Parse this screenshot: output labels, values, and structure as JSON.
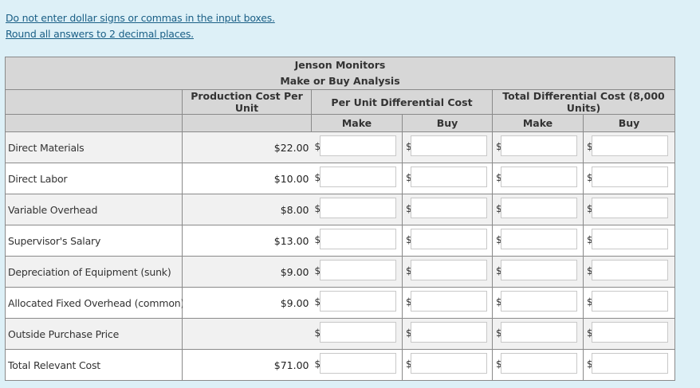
{
  "notes": [
    "Do not enter dollar signs or commas in the input boxes.",
    "Round all answers to 2 decimal places."
  ],
  "table": {
    "company": "Jenson Monitors",
    "analysis": "Make or Buy Analysis",
    "col_production": "Production Cost Per Unit",
    "col_per_unit": "Per Unit Differential Cost",
    "col_total": "Total Differential Cost (8,000 Units)",
    "make": "Make",
    "buy": "Buy",
    "currency": "$",
    "rows": [
      {
        "label": "Direct Materials",
        "cost": "$22.00"
      },
      {
        "label": "Direct Labor",
        "cost": "$10.00"
      },
      {
        "label": "Variable Overhead",
        "cost": "$8.00"
      },
      {
        "label": "Supervisor's Salary",
        "cost": "$13.00"
      },
      {
        "label": "Depreciation of Equipment (sunk)",
        "cost": "$9.00"
      },
      {
        "label": "Allocated Fixed Overhead (common)",
        "cost": "$9.00"
      },
      {
        "label": "Outside Purchase Price",
        "cost": ""
      },
      {
        "label": "Total Relevant Cost",
        "cost": "$71.00"
      }
    ]
  }
}
